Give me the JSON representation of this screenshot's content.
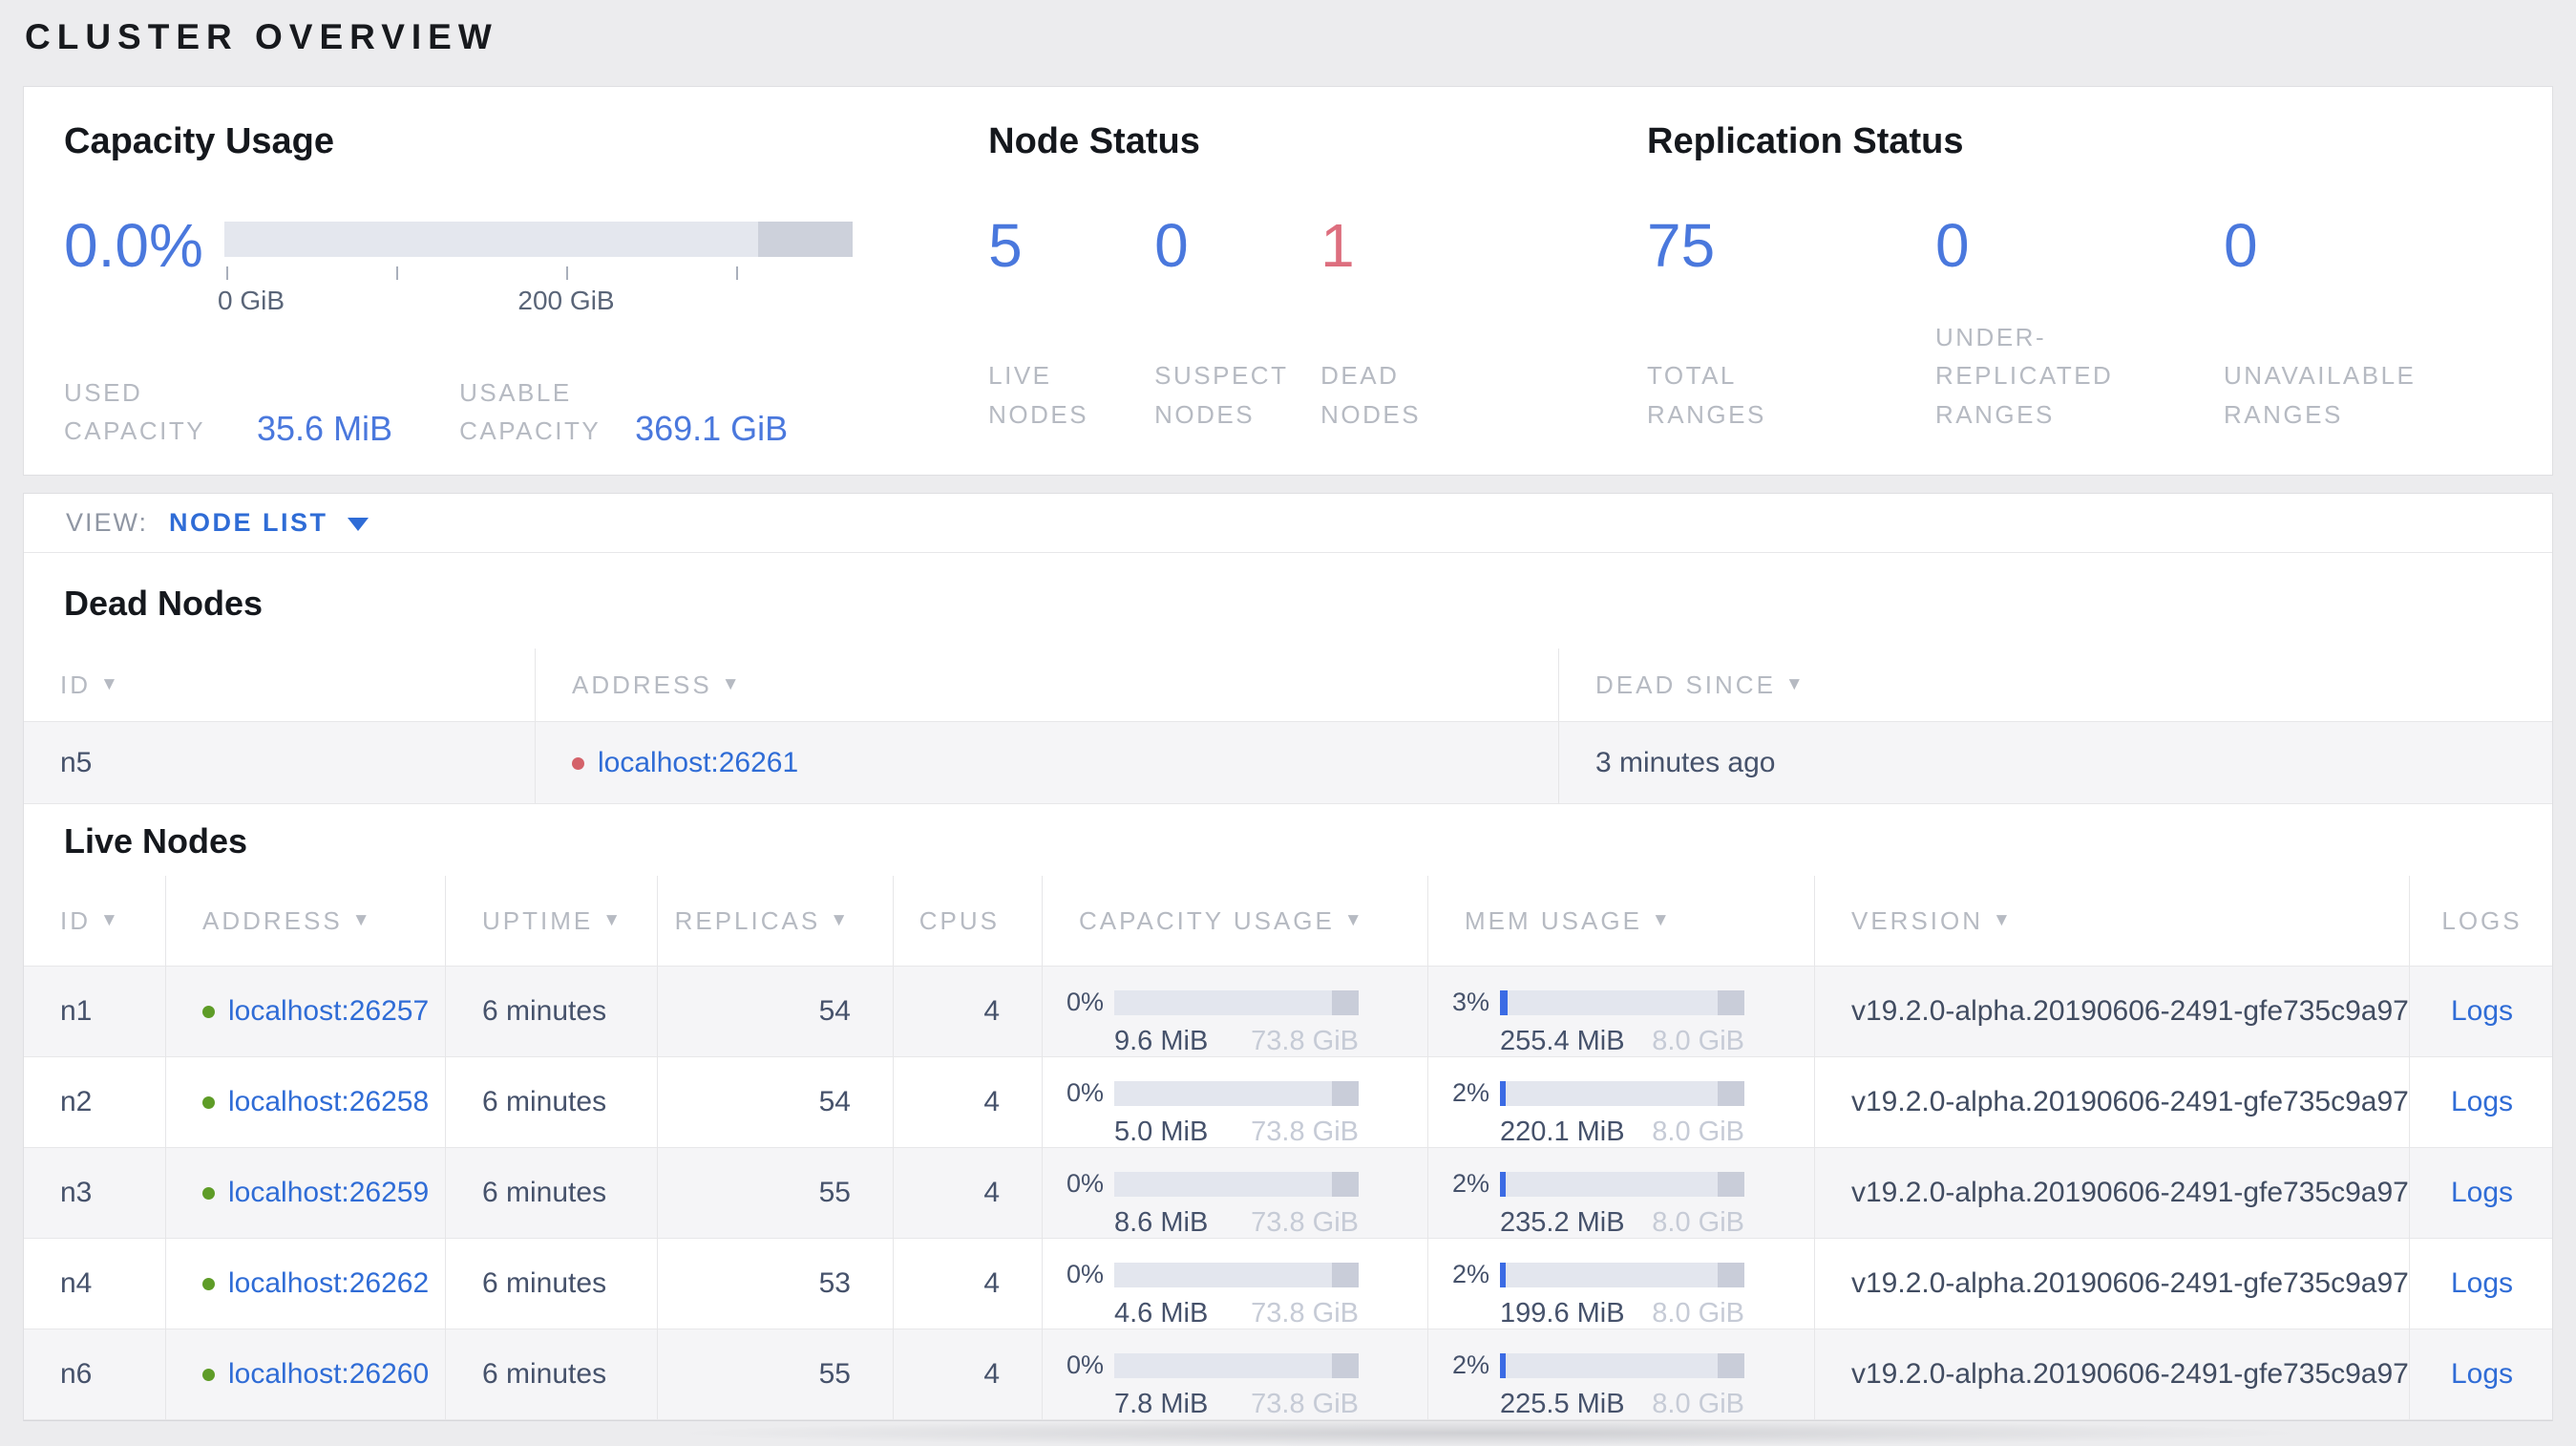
{
  "page_title": "CLUSTER OVERVIEW",
  "icons": {
    "sort": "▼"
  },
  "colors": {
    "accent_blue": "#4a78dd",
    "link_blue": "#2f6cd6",
    "danger_red": "#dd6e7e",
    "live_dot_green": "#5e9c27",
    "dead_dot_red": "#d4626a"
  },
  "summary": {
    "capacity": {
      "title": "Capacity Usage",
      "percent": "0.0%",
      "axis_tick_labels": [
        "0 GiB",
        "200 GiB"
      ],
      "used_label": "USED CAPACITY",
      "used_value": "35.6 MiB",
      "usable_label": "USABLE CAPACITY",
      "usable_value": "369.1 GiB"
    },
    "node_status": {
      "title": "Node Status",
      "stats": [
        {
          "value": "5",
          "label": "LIVE NODES",
          "tone": "blue"
        },
        {
          "value": "0",
          "label": "SUSPECT NODES",
          "tone": "blue"
        },
        {
          "value": "1",
          "label": "DEAD NODES",
          "tone": "red"
        }
      ]
    },
    "replication": {
      "title": "Replication Status",
      "stats": [
        {
          "value": "75",
          "label": "TOTAL RANGES",
          "tone": "blue"
        },
        {
          "value": "0",
          "label": "UNDER-REPLICATED RANGES",
          "tone": "blue"
        },
        {
          "value": "0",
          "label": "UNAVAILABLE RANGES",
          "tone": "blue"
        }
      ]
    }
  },
  "view_bar": {
    "label": "VIEW:",
    "value": "NODE LIST"
  },
  "dead_nodes": {
    "title": "Dead Nodes",
    "columns": [
      {
        "label": "ID",
        "sortable": true
      },
      {
        "label": "ADDRESS",
        "sortable": true
      },
      {
        "label": "DEAD SINCE",
        "sortable": true
      }
    ],
    "rows": [
      {
        "id": "n5",
        "address": "localhost:26261",
        "dead_since": "3 minutes ago"
      }
    ]
  },
  "live_nodes": {
    "title": "Live Nodes",
    "columns": [
      {
        "label": "ID",
        "sortable": true
      },
      {
        "label": "ADDRESS",
        "sortable": true
      },
      {
        "label": "UPTIME",
        "sortable": true
      },
      {
        "label": "REPLICAS",
        "sortable": true
      },
      {
        "label": "CPUS",
        "sortable": false
      },
      {
        "label": "CAPACITY USAGE",
        "sortable": true
      },
      {
        "label": "MEM USAGE",
        "sortable": true
      },
      {
        "label": "VERSION",
        "sortable": true
      },
      {
        "label": "LOGS",
        "sortable": false
      }
    ],
    "rows": [
      {
        "id": "n1",
        "address": "localhost:26257",
        "uptime": "6 minutes",
        "replicas": "54",
        "cpus": "4",
        "capacity_pct": "0%",
        "capacity_used": "9.6 MiB",
        "capacity_total": "73.8 GiB",
        "mem_pct": "3%",
        "mem_used": "255.4 MiB",
        "mem_total": "8.0 GiB",
        "version": "v19.2.0-alpha.20190606-2491-gfe735c9a97",
        "logs_label": "Logs"
      },
      {
        "id": "n2",
        "address": "localhost:26258",
        "uptime": "6 minutes",
        "replicas": "54",
        "cpus": "4",
        "capacity_pct": "0%",
        "capacity_used": "5.0 MiB",
        "capacity_total": "73.8 GiB",
        "mem_pct": "2%",
        "mem_used": "220.1 MiB",
        "mem_total": "8.0 GiB",
        "version": "v19.2.0-alpha.20190606-2491-gfe735c9a97",
        "logs_label": "Logs"
      },
      {
        "id": "n3",
        "address": "localhost:26259",
        "uptime": "6 minutes",
        "replicas": "55",
        "cpus": "4",
        "capacity_pct": "0%",
        "capacity_used": "8.6 MiB",
        "capacity_total": "73.8 GiB",
        "mem_pct": "2%",
        "mem_used": "235.2 MiB",
        "mem_total": "8.0 GiB",
        "version": "v19.2.0-alpha.20190606-2491-gfe735c9a97",
        "logs_label": "Logs"
      },
      {
        "id": "n4",
        "address": "localhost:26262",
        "uptime": "6 minutes",
        "replicas": "53",
        "cpus": "4",
        "capacity_pct": "0%",
        "capacity_used": "4.6 MiB",
        "capacity_total": "73.8 GiB",
        "mem_pct": "2%",
        "mem_used": "199.6 MiB",
        "mem_total": "8.0 GiB",
        "version": "v19.2.0-alpha.20190606-2491-gfe735c9a97",
        "logs_label": "Logs"
      },
      {
        "id": "n6",
        "address": "localhost:26260",
        "uptime": "6 minutes",
        "replicas": "55",
        "cpus": "4",
        "capacity_pct": "0%",
        "capacity_used": "7.8 MiB",
        "capacity_total": "73.8 GiB",
        "mem_pct": "2%",
        "mem_used": "225.5 MiB",
        "mem_total": "8.0 GiB",
        "version": "v19.2.0-alpha.20190606-2491-gfe735c9a97",
        "logs_label": "Logs"
      }
    ]
  }
}
